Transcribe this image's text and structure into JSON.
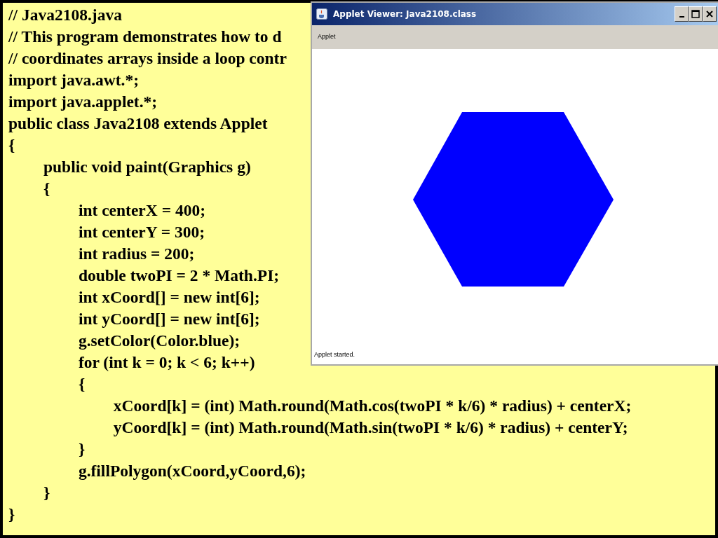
{
  "code_lines": [
    "// Java2108.java",
    "// This program demonstrates how to d",
    "// coordinates arrays inside a loop contr",
    "import java.awt.*;",
    "import java.applet.*;",
    "public class Java2108 extends Applet",
    "{",
    "\tpublic void paint(Graphics g)",
    "\t{",
    "\t\tint centerX = 400;",
    "\t\tint centerY = 300;",
    "\t\tint radius = 200;",
    "\t\tdouble twoPI = 2 * Math.PI;",
    "\t\tint xCoord[] = new int[6];",
    "\t\tint yCoord[] = new int[6];",
    "\t\tg.setColor(Color.blue);",
    "\t\tfor (int k = 0; k < 6; k++)",
    "\t\t{",
    "\t\t\txCoord[k] = (int) Math.round(Math.cos(twoPI * k/6) * radius) + centerX;",
    "\t\t\tyCoord[k] = (int) Math.round(Math.sin(twoPI * k/6) * radius) + centerY;",
    "\t\t}",
    "\t\tg.fillPolygon(xCoord,yCoord,6);",
    "\t}",
    "}"
  ],
  "applet_window": {
    "title": "Applet Viewer: Java2108.class",
    "menu": [
      "Applet"
    ],
    "status_bar": "Applet started."
  }
}
